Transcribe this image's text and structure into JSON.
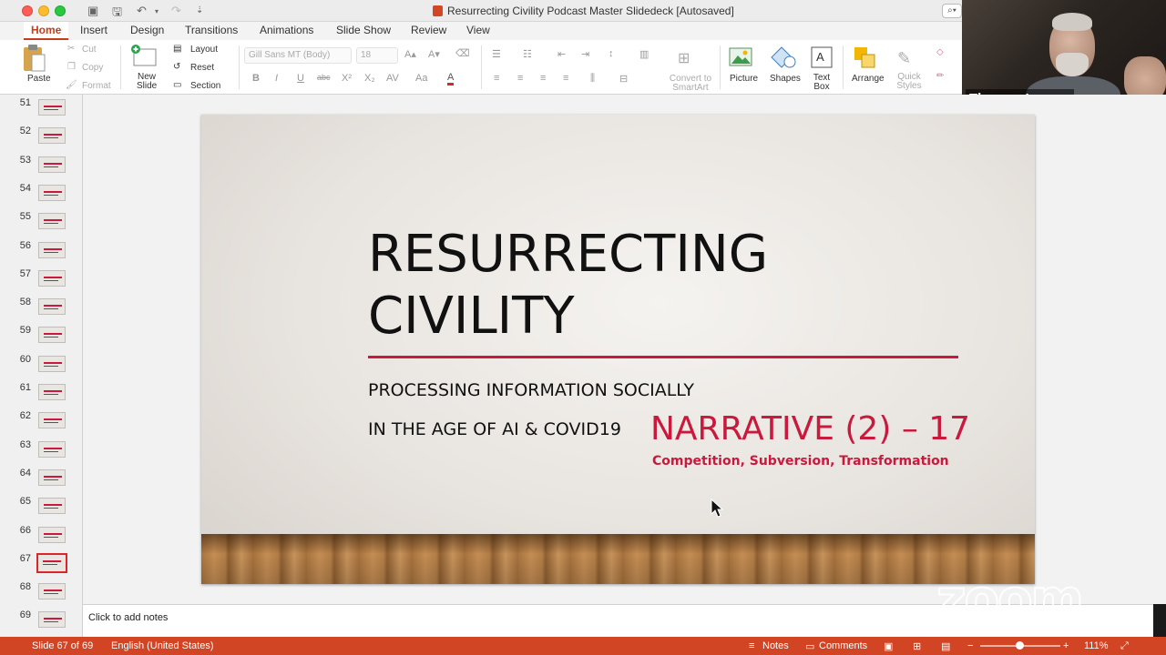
{
  "window": {
    "title": "Resurrecting Civility Podcast Master Slidedeck [Autosaved]"
  },
  "ribbon_tabs": [
    {
      "label": "Home",
      "active": true
    },
    {
      "label": "Insert"
    },
    {
      "label": "Design"
    },
    {
      "label": "Transitions"
    },
    {
      "label": "Animations"
    },
    {
      "label": "Slide Show"
    },
    {
      "label": "Review"
    },
    {
      "label": "View"
    }
  ],
  "ribbon": {
    "paste": "Paste",
    "cut": "Cut",
    "copy": "Copy",
    "format": "Format",
    "new_slide": "New Slide",
    "layout": "Layout",
    "reset": "Reset",
    "section": "Section",
    "font_name": "Gill Sans MT (Body)",
    "font_size": "18",
    "convert_smartart": "Convert to SmartArt",
    "picture": "Picture",
    "shapes": "Shapes",
    "text_box": "Text Box",
    "arrange": "Arrange",
    "quick_styles": "Quick Styles"
  },
  "video": {
    "participant_name": "Thomas Loug..."
  },
  "thumbnails": {
    "numbers": [
      "51",
      "52",
      "53",
      "54",
      "55",
      "56",
      "57",
      "58",
      "59",
      "60",
      "61",
      "62",
      "63",
      "64",
      "65",
      "66",
      "67",
      "68",
      "69"
    ],
    "selected": "67"
  },
  "slide": {
    "title": "RESURRECTING\nCIVILITY",
    "subtitle_line1": "PROCESSING INFORMATION SOCIALLY",
    "subtitle_line2": "IN THE AGE OF AI & COVID19",
    "narrative": "NARRATIVE (2) – 17",
    "tagline": "Competition, Subversion, Transformation"
  },
  "notes": {
    "placeholder": "Click to add notes"
  },
  "watermark": "zoom",
  "status": {
    "slide_indicator": "Slide 67 of 69",
    "language": "English (United States)",
    "notes": "Notes",
    "comments": "Comments",
    "zoom_level": "111%"
  },
  "colors": {
    "accent": "#c43e1c",
    "slide_accent": "#c9193d",
    "statusbar": "#d14424"
  }
}
